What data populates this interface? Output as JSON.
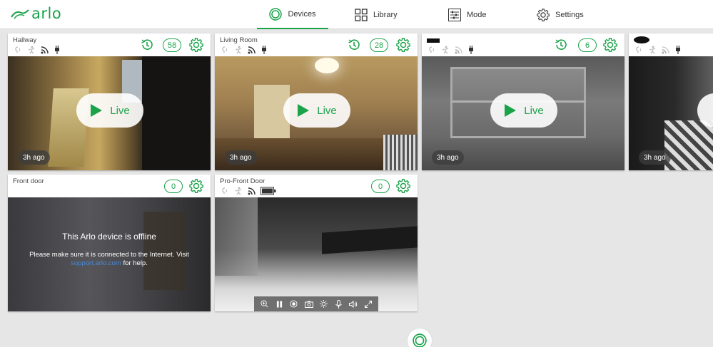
{
  "brand": {
    "logo_text": "arlo",
    "accent": "#1ba34a"
  },
  "nav": {
    "devices": "Devices",
    "library": "Library",
    "mode": "Mode",
    "settings": "Settings"
  },
  "cards": [
    {
      "name": "Hallway",
      "count": "58",
      "live_label": "Live",
      "ago": "3h ago",
      "power": "plugged"
    },
    {
      "name": "Living Room",
      "count": "28",
      "live_label": "Live",
      "ago": "3h ago",
      "power": "plugged"
    },
    {
      "name": "",
      "count": "6",
      "live_label": "Live",
      "ago": "3h ago",
      "power": "plugged"
    },
    {
      "name": "",
      "ago": "3h ago",
      "power": "plugged"
    },
    {
      "name": "Front door",
      "count": "0",
      "offline_title": "This Arlo device is offline",
      "offline_msg": "Please make sure it is connected to the Internet. Visit",
      "offline_link": "support.arlo.com",
      "offline_suffix": "for help."
    },
    {
      "name": "Pro-Front Door",
      "count": "0",
      "power": "battery"
    }
  ],
  "icons": {
    "history": "history-icon",
    "settings": "gear-icon",
    "play": "play-icon",
    "audio": "audio-icon",
    "motion": "motion-icon",
    "signal": "signal-icon",
    "plug": "plug-icon",
    "battery": "battery-icon"
  },
  "controls": [
    "zoom-in-icon",
    "pause-icon",
    "record-icon",
    "camera-icon",
    "brightness-icon",
    "microphone-icon",
    "speaker-icon",
    "fullscreen-icon"
  ]
}
